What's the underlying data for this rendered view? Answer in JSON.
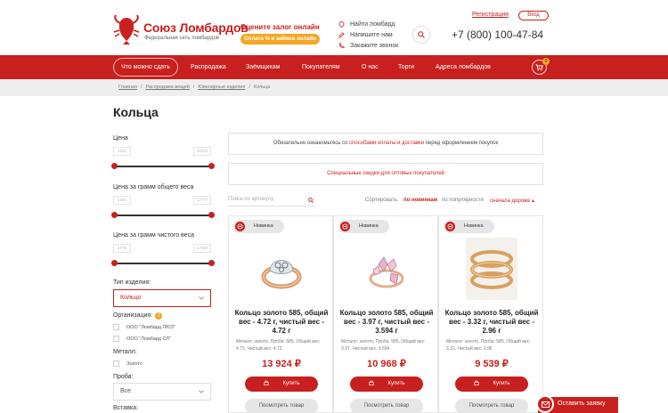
{
  "header": {
    "logo_title": "Союз Ломбардов",
    "logo_sub": "Федеральная сеть ломбардов",
    "promo_title": "Оцените залог онлайн",
    "promo_button": "Оплата % и займов онлайн",
    "quick_links": [
      "Найти ломбард",
      "Напишите нам",
      "Закажите звонок"
    ],
    "phone": "+7 (800) 100-47-84",
    "register": "Регистрация",
    "login": "Вход"
  },
  "nav": {
    "pill": "Что можно сдать",
    "items": [
      "Распродажа",
      "Заёмщикам",
      "Покупателям",
      "О нас",
      "Торги",
      "Адреса ломбардов"
    ],
    "cart_count": "0"
  },
  "breadcrumbs": [
    "Главная",
    "Распродажа вещей",
    "Ювелирные изделия",
    "Кольца"
  ],
  "page_title": "Кольца",
  "sidebar": {
    "price_label": "Цена",
    "price_min": "1962",
    "price_max": "94634",
    "gross_label": "Цена за грамм общего веса",
    "gross_min": "1940",
    "gross_max": "12777",
    "net_label": "Цена за грамм чистого веса",
    "net_min": "2775",
    "net_max": "17389",
    "type_label": "Тип изделия:",
    "type_value": "Кольцо",
    "org_label": "Организация:",
    "orgs": [
      "ООО \"Ломбард ЛЮЗ\"",
      "ООО \"Ломбард СЛ\""
    ],
    "metal_label": "Металл:",
    "metal_value": "Золото",
    "probe_label": "Проба:",
    "probe_value": "Все",
    "insert_label": "Вставка:"
  },
  "notices": {
    "notice1_pre": "Обязательно ознакомьтесь со ",
    "notice1_link": "способами оплаты и доставки",
    "notice1_post": " перед оформлением покупок",
    "notice2": "Специальные скидки для оптовых покупателей"
  },
  "search": {
    "placeholder": "Поиск по артикулу"
  },
  "sort": {
    "label": "Сортировать:",
    "options": [
      "по новинкам",
      "по популярности",
      "сначала дороже"
    ]
  },
  "products": [
    {
      "badge": "Новинка",
      "title": "Кольцо золото 585, общий вес - 4.72 г, чистый вес - 4.72 г",
      "desc": "Металл: золото, Проба: 585, Общий вес: 4.72, Чистый вес: 4.72",
      "price": "13 924 ₽",
      "buy": "Купить",
      "view": "Посмотреть товар"
    },
    {
      "badge": "Новинка",
      "title": "Кольцо золото 585, общий вес - 3.97 г, чистый вес - 3.594 г",
      "desc": "Металл: золото, Проба: 585, Общий вес: 3.97, Чистый вес: 3.594",
      "price": "10 968 ₽",
      "buy": "Купить",
      "view": "Посмотреть товар"
    },
    {
      "badge": "Новинка",
      "title": "Кольцо золото 585, общий вес - 3.32 г, чистый вес - 2.96 г",
      "desc": "Металл: золото, Проба: 585, Общий вес: 3.32, Чистый вес: 2.96",
      "price": "9 539 ₽",
      "buy": "Купить",
      "view": "Посмотреть товар"
    }
  ],
  "request_button": "Оставить заявку",
  "colors": {
    "brand": "#c8201e",
    "accent": "#f5a623"
  }
}
